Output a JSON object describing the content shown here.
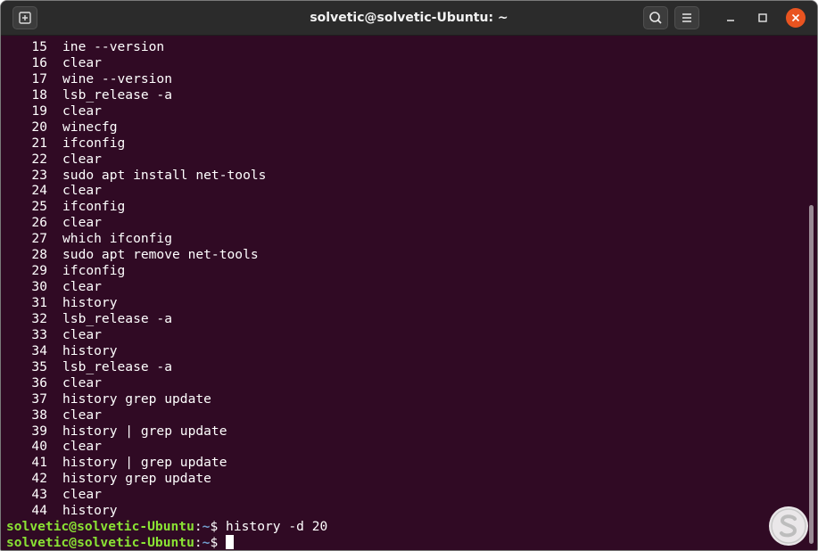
{
  "window": {
    "title": "solvetic@solvetic-Ubuntu: ~"
  },
  "colors": {
    "terminal_bg": "#300a24",
    "titlebar_bg": "#2b2b2b",
    "prompt_user": "#8ae234",
    "prompt_path": "#729fcf",
    "close_button": "#e95420"
  },
  "icons": {
    "new_tab": "new-tab-icon",
    "search": "search-icon",
    "menu": "hamburger-menu-icon",
    "minimize": "minimize-icon",
    "maximize": "maximize-icon",
    "close": "close-icon"
  },
  "history": [
    {
      "num": "15",
      "cmd": "ine --version"
    },
    {
      "num": "16",
      "cmd": "clear"
    },
    {
      "num": "17",
      "cmd": "wine --version"
    },
    {
      "num": "18",
      "cmd": "lsb_release -a"
    },
    {
      "num": "19",
      "cmd": "clear"
    },
    {
      "num": "20",
      "cmd": "winecfg"
    },
    {
      "num": "21",
      "cmd": "ifconfig"
    },
    {
      "num": "22",
      "cmd": "clear"
    },
    {
      "num": "23",
      "cmd": "sudo apt install net-tools"
    },
    {
      "num": "24",
      "cmd": "clear"
    },
    {
      "num": "25",
      "cmd": "ifconfig"
    },
    {
      "num": "26",
      "cmd": "clear"
    },
    {
      "num": "27",
      "cmd": "which ifconfig"
    },
    {
      "num": "28",
      "cmd": "sudo apt remove net-tools"
    },
    {
      "num": "29",
      "cmd": "ifconfig"
    },
    {
      "num": "30",
      "cmd": "clear"
    },
    {
      "num": "31",
      "cmd": "history"
    },
    {
      "num": "32",
      "cmd": "lsb_release -a"
    },
    {
      "num": "33",
      "cmd": "clear"
    },
    {
      "num": "34",
      "cmd": "history"
    },
    {
      "num": "35",
      "cmd": "lsb_release -a"
    },
    {
      "num": "36",
      "cmd": "clear"
    },
    {
      "num": "37",
      "cmd": "history grep update"
    },
    {
      "num": "38",
      "cmd": "clear"
    },
    {
      "num": "39",
      "cmd": "history | grep update"
    },
    {
      "num": "40",
      "cmd": "clear"
    },
    {
      "num": "41",
      "cmd": "history | grep update"
    },
    {
      "num": "42",
      "cmd": "history grep update"
    },
    {
      "num": "43",
      "cmd": "clear"
    },
    {
      "num": "44",
      "cmd": "history"
    }
  ],
  "prompts": [
    {
      "user": "solvetic@solvetic-Ubuntu",
      "sep": ":",
      "path": "~",
      "symbol": "$",
      "cmd": " history -d 20"
    },
    {
      "user": "solvetic@solvetic-Ubuntu",
      "sep": ":",
      "path": "~",
      "symbol": "$",
      "cmd": " "
    }
  ]
}
